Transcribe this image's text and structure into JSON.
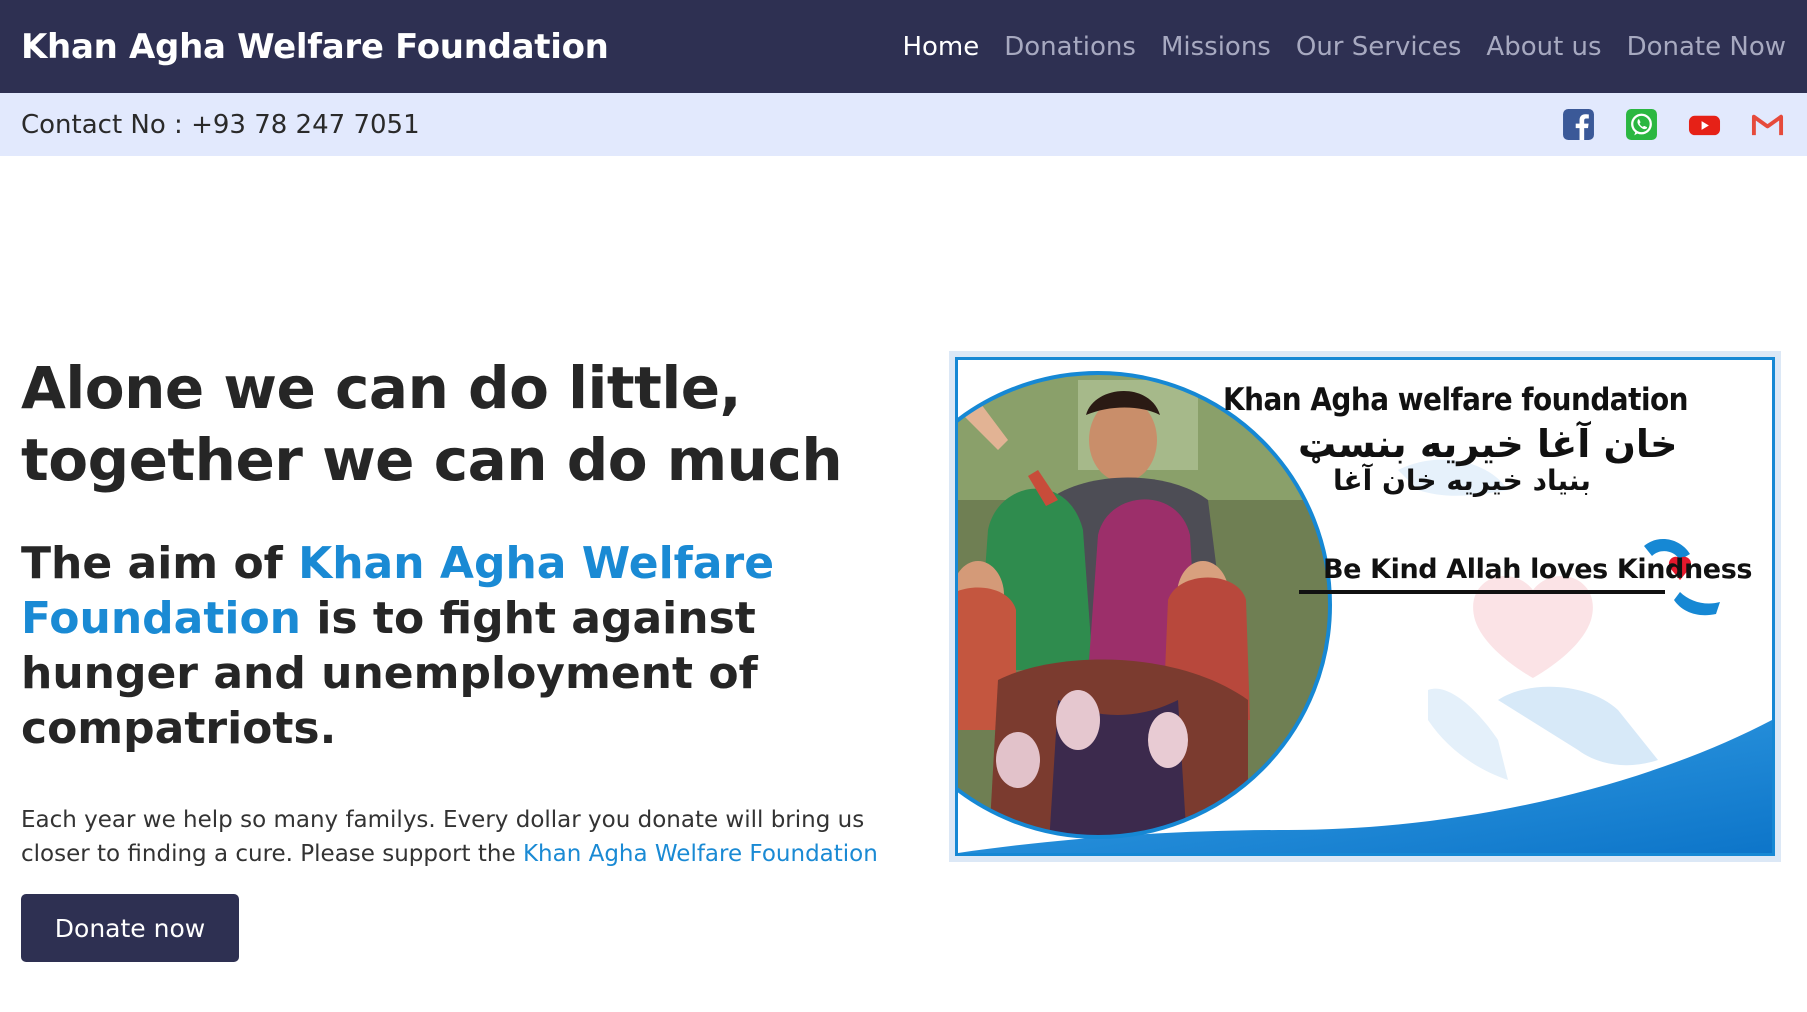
{
  "brand": "Khan Agha Welfare Foundation",
  "nav": {
    "home": "Home",
    "donations": "Donations",
    "missions": "Missions",
    "services": "Our Services",
    "about": "About us",
    "donate": "Donate Now"
  },
  "contact": {
    "text": "Contact No : +93 78 247 7051"
  },
  "socials": [
    "facebook-icon",
    "whatsapp-icon",
    "youtube-icon",
    "gmail-icon"
  ],
  "hero": {
    "headline_line1": "Alone we can do little,",
    "headline_line2": "together we can do much",
    "sub_pre": "The aim of ",
    "sub_highlight": "Khan Agha Welfare Foundation",
    "sub_post": " is to fight against hunger and unemployment of compatriots.",
    "para": "Each year we help so many familys. Every dollar you donate will bring us closer to finding a cure. Please support the ",
    "para_link": "Khan Agha Welfare Foundation",
    "button": "Donate now"
  },
  "banner": {
    "title": "Khan Agha welfare foundation",
    "urdu_line1": "خان آغا خیریه بنسټ",
    "urdu_line2": "بنیاد خیریه خان آغا",
    "slogan": "Be Kind Allah loves Kindness"
  },
  "colors": {
    "navbar": "#2e3052",
    "contact_bar": "#e2e9fd",
    "accent": "#1a8ad4",
    "button": "#2e3052"
  }
}
